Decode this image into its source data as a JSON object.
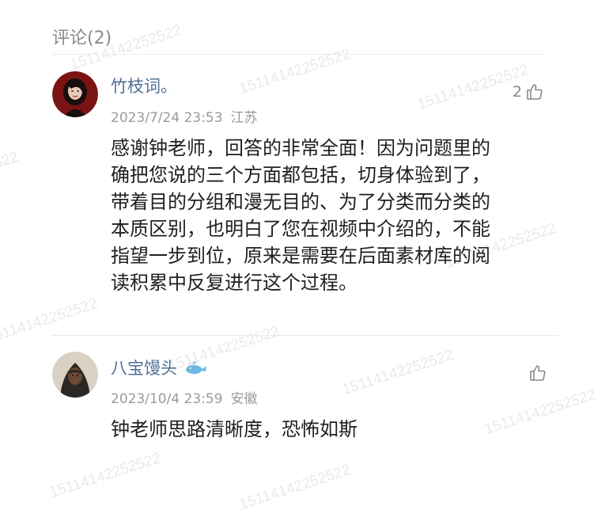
{
  "section": {
    "title": "评论(2)"
  },
  "watermark_text": "15114142252522",
  "comments": [
    {
      "username": "竹枝词。",
      "date": "2023/7/24 23:53",
      "location": "江苏",
      "likes": "2",
      "text_lines": [
        "感谢钟老师，回答的非常全面！因为问题里的",
        "确把您说的三个方面都包括，切身体验到了，",
        "带着目的分组和漫无目的、为了分类而分类的",
        "本质区别，也明白了您在视频中介绍的，不能",
        "指望一步到位，原来是需要在后面素材库的阅",
        "读积累中反复进行这个过程。"
      ]
    },
    {
      "username": "八宝馒头",
      "date": "2023/10/4 23:59",
      "location": "安徽",
      "likes": "",
      "text_lines": [
        "钟老师思路清晰度，恐怖如斯"
      ]
    }
  ],
  "icons": {
    "like": "thumbs-up-icon",
    "badge": "whale-icon"
  }
}
